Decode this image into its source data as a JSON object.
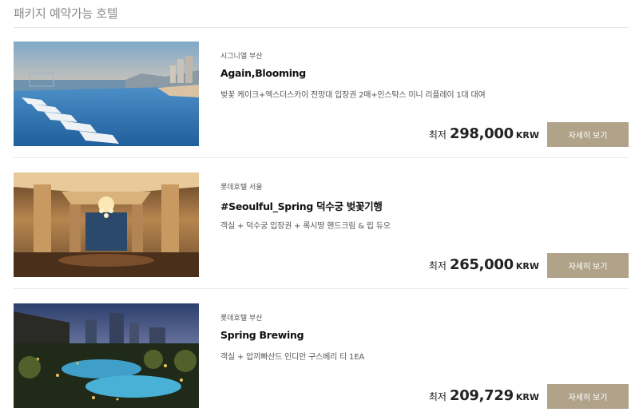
{
  "section": {
    "title": "패키지 예약가능 호텔"
  },
  "packages": [
    {
      "hotel": "시그니엘 부산",
      "title": "Again,Blooming",
      "description": "벚꽃 케이크+엑스더스카이 전망대 입장권 2매+인스탁스 미니 리플레이 1대 대여",
      "price_prefix": "최저",
      "price": "298,000",
      "currency": "KRW",
      "button_label": "자세히 보기"
    },
    {
      "hotel": "롯데호텔 서울",
      "title": "#Seoulful_Spring 덕수궁 벚꽃기행",
      "description": "객실 + 덕수궁 입장권 + 록시땅 핸드크림 & 립 듀오",
      "price_prefix": "최저",
      "price": "265,000",
      "currency": "KRW",
      "button_label": "자세히 보기"
    },
    {
      "hotel": "롯데호텔 부산",
      "title": "Spring Brewing",
      "description": "객실 + 압끼빠산드 인디안 구스베리 티 1EA",
      "price_prefix": "최저",
      "price": "209,729",
      "currency": "KRW",
      "button_label": "자세히 보기"
    }
  ],
  "colors": {
    "button": "#b0a38a",
    "divider": "#e9e9e9",
    "title_gray": "#8a8a8a"
  }
}
